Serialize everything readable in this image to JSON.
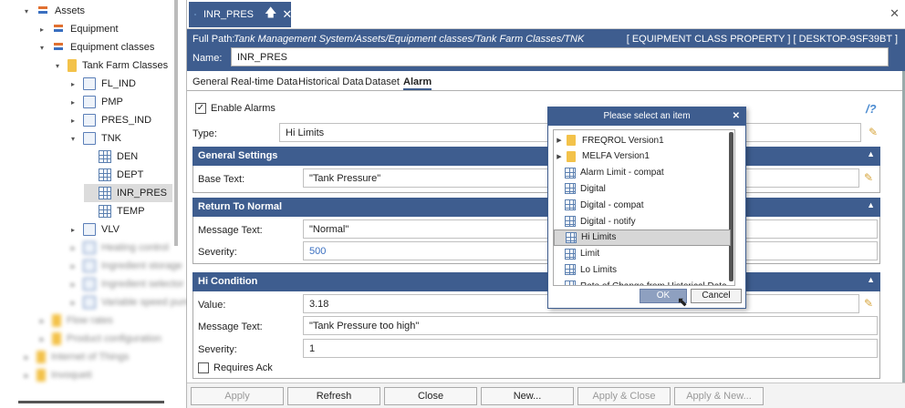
{
  "tree": {
    "items": [
      {
        "label": "Assets",
        "level": 0,
        "icon": "assets-icon",
        "arrow": "▾",
        "blurred": false
      },
      {
        "label": "Equipment",
        "level": 1,
        "icon": "equipment-icon",
        "arrow": "▸",
        "blurred": false
      },
      {
        "label": "Equipment classes",
        "level": 1,
        "icon": "equipment-classes-icon",
        "arrow": "▾",
        "blurred": false
      },
      {
        "label": "Tank Farm Classes",
        "level": 2,
        "icon": "folder-icon",
        "arrow": "▾",
        "blurred": false
      },
      {
        "label": "FL_IND",
        "level": 3,
        "icon": "class-icon",
        "arrow": "▸",
        "blurred": false
      },
      {
        "label": "PMP",
        "level": 3,
        "icon": "class-icon",
        "arrow": "▸",
        "blurred": false
      },
      {
        "label": "PRES_IND",
        "level": 3,
        "icon": "class-icon",
        "arrow": "▸",
        "blurred": false
      },
      {
        "label": "TNK",
        "level": 3,
        "icon": "class-icon",
        "arrow": "▾",
        "blurred": false
      },
      {
        "label": "DEN",
        "level": 4,
        "icon": "property-icon",
        "arrow": "",
        "blurred": false
      },
      {
        "label": "DEPT",
        "level": 4,
        "icon": "property-icon",
        "arrow": "",
        "blurred": false
      },
      {
        "label": "INR_PRES",
        "level": 4,
        "icon": "property-icon",
        "arrow": "",
        "blurred": false,
        "selected": true
      },
      {
        "label": "TEMP",
        "level": 4,
        "icon": "property-icon",
        "arrow": "",
        "blurred": false
      },
      {
        "label": "VLV",
        "level": 3,
        "icon": "class-icon",
        "arrow": "▸",
        "blurred": false
      },
      {
        "label": "Heating control",
        "level": 3,
        "icon": "class-icon",
        "arrow": "▸",
        "blurred": true
      },
      {
        "label": "Ingredient storage",
        "level": 3,
        "icon": "class-icon",
        "arrow": "▸",
        "blurred": true
      },
      {
        "label": "Ingredient selector",
        "level": 3,
        "icon": "class-icon",
        "arrow": "▸",
        "blurred": true
      },
      {
        "label": "Variable speed pump",
        "level": 3,
        "icon": "class-icon",
        "arrow": "▸",
        "blurred": true
      },
      {
        "label": "Flow rates",
        "level": 1,
        "icon": "folder-icon",
        "arrow": "▸",
        "blurred": true
      },
      {
        "label": "Product configuration",
        "level": 1,
        "icon": "folder-icon",
        "arrow": "▸",
        "blurred": true
      },
      {
        "label": "Internet of Things",
        "level": 0,
        "icon": "folder-icon",
        "arrow": "▸",
        "blurred": true
      },
      {
        "label": "Invoqueti",
        "level": 0,
        "icon": "folder-icon",
        "arrow": "▸",
        "blurred": true
      }
    ]
  },
  "doc_tab": {
    "title": "INR_PRES"
  },
  "header": {
    "full_path_label": "Full Path:",
    "full_path": "Tank Management System/Assets/Equipment classes/Tank Farm Classes/TNK",
    "type_info": "[ EQUIPMENT CLASS PROPERTY ] [ DESKTOP-9SF39BT ]",
    "name_label": "Name:",
    "name_value": "INR_PRES"
  },
  "tabs": [
    "General",
    "Real-time Data",
    "Historical Data",
    "Dataset",
    "Alarm"
  ],
  "active_tab": "Alarm",
  "alarm": {
    "enable_label": "Enable Alarms",
    "enabled": true,
    "type_label": "Type:",
    "type_value": "Hi Limits",
    "general": {
      "title": "General Settings",
      "base_text_label": "Base Text:",
      "base_text": "\"Tank Pressure\""
    },
    "rtn": {
      "title": "Return To Normal",
      "message_label": "Message Text:",
      "message": "\"Normal\"",
      "severity_label": "Severity:",
      "severity": "500"
    },
    "hi": {
      "title": "Hi Condition",
      "value_label": "Value:",
      "value": "3.18",
      "message_label": "Message Text:",
      "message": "\"Tank Pressure too high\"",
      "severity_label": "Severity:",
      "severity": "1",
      "ack_label": "Requires Ack"
    }
  },
  "buttons": {
    "apply": "Apply",
    "refresh": "Refresh",
    "close": "Close",
    "new": "New...",
    "apply_close": "Apply & Close",
    "apply_new": "Apply & New..."
  },
  "dialog": {
    "title": "Please select an item",
    "items": [
      {
        "label": "FREQROL Version1",
        "kind": "folder",
        "arrow": "▶"
      },
      {
        "label": "MELFA Version1",
        "kind": "folder",
        "arrow": "▶"
      },
      {
        "label": "Alarm Limit - compat",
        "kind": "grid",
        "arrow": ""
      },
      {
        "label": "Digital",
        "kind": "grid",
        "arrow": ""
      },
      {
        "label": "Digital - compat",
        "kind": "grid",
        "arrow": ""
      },
      {
        "label": "Digital - notify",
        "kind": "grid",
        "arrow": ""
      },
      {
        "label": "Hi Limits",
        "kind": "grid",
        "arrow": "",
        "selected": true
      },
      {
        "label": "Limit",
        "kind": "grid",
        "arrow": ""
      },
      {
        "label": "Lo Limits",
        "kind": "grid",
        "arrow": ""
      },
      {
        "label": "Rate of Change from Historical Data",
        "kind": "grid",
        "arrow": ""
      }
    ],
    "ok": "OK",
    "cancel": "Cancel"
  },
  "colors": {
    "accent": "#3e5d8f",
    "edit_icon": "#d6a43a"
  }
}
